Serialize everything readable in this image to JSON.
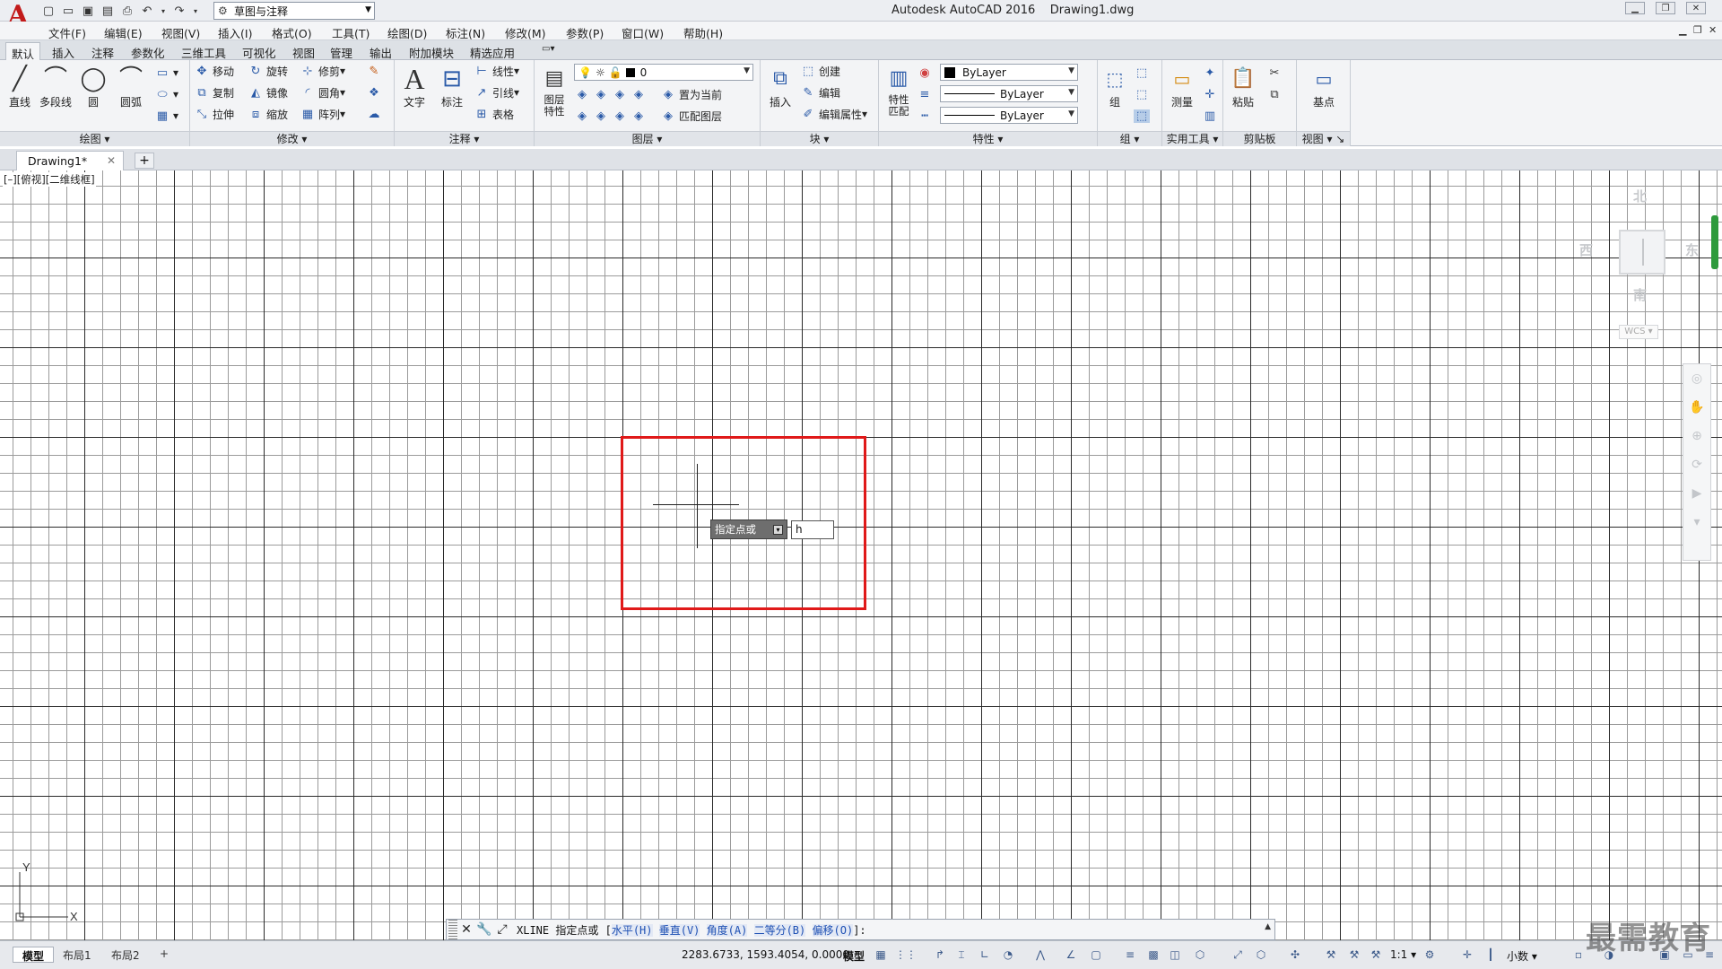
{
  "window": {
    "title": "Autodesk AutoCAD 2016    Drawing1.dwg",
    "app_logo": "A",
    "workspace": "草图与注释"
  },
  "menu": [
    "文件(F)",
    "编辑(E)",
    "视图(V)",
    "插入(I)",
    "格式(O)",
    "工具(T)",
    "绘图(D)",
    "标注(N)",
    "修改(M)",
    "参数(P)",
    "窗口(W)",
    "帮助(H)"
  ],
  "ribbon_tabs": [
    "默认",
    "插入",
    "注释",
    "参数化",
    "三维工具",
    "可视化",
    "视图",
    "管理",
    "输出",
    "附加模块",
    "精选应用"
  ],
  "ribbon": {
    "draw": {
      "title": "绘图",
      "line": "直线",
      "polyline": "多段线",
      "circle": "圆",
      "arc": "圆弧"
    },
    "modify": {
      "title": "修改",
      "move": "移动",
      "rotate": "旋转",
      "trim": "修剪",
      "copy": "复制",
      "mirror": "镜像",
      "fillet": "圆角",
      "stretch": "拉伸",
      "scale": "缩放",
      "array": "阵列"
    },
    "annotation": {
      "title": "注释",
      "text": "文字",
      "dimension": "标注",
      "linear": "线性",
      "leader": "引线",
      "table": "表格"
    },
    "layers": {
      "title": "图层",
      "layer_props": "图层\n特性",
      "layer_name": "0",
      "set_current": "置为当前",
      "match_layer": "匹配图层"
    },
    "block": {
      "title": "块",
      "insert": "插入",
      "create": "创建",
      "edit": "编辑",
      "edit_attr": "编辑属性"
    },
    "properties": {
      "title": "特性",
      "match": "特性\n匹配",
      "color": "ByLayer",
      "linetype": "ByLayer",
      "lineweight": "ByLayer"
    },
    "groups": {
      "title": "组",
      "group": "组"
    },
    "utilities": {
      "title": "实用工具",
      "measure": "测量"
    },
    "clipboard": {
      "title": "剪贴板",
      "paste": "粘贴"
    },
    "view": {
      "title": "视图",
      "base": "基点"
    }
  },
  "doc_tab": {
    "name": "Drawing1*"
  },
  "viewport": {
    "label": "[–][俯视][二维线框]",
    "viewcube": {
      "north": "北",
      "south": "南",
      "east": "东",
      "west": "西",
      "wcs": "WCS"
    }
  },
  "prompt": {
    "tooltip": "指定点或",
    "input_value": "h"
  },
  "ucs": {
    "x": "X",
    "y": "Y"
  },
  "command_line": {
    "prefix": "XLINE 指定点或 [",
    "options": [
      "水平(H)",
      "垂直(V)",
      "角度(A)",
      "二等分(B)",
      "偏移(O)"
    ],
    "suffix": "]:"
  },
  "status": {
    "layouts": [
      "模型",
      "布局1",
      "布局2"
    ],
    "coords": "2283.6733, 1593.4054, 0.0000",
    "model": "模型",
    "scale": "1:1",
    "units": "小数"
  },
  "watermark": "最需教育"
}
